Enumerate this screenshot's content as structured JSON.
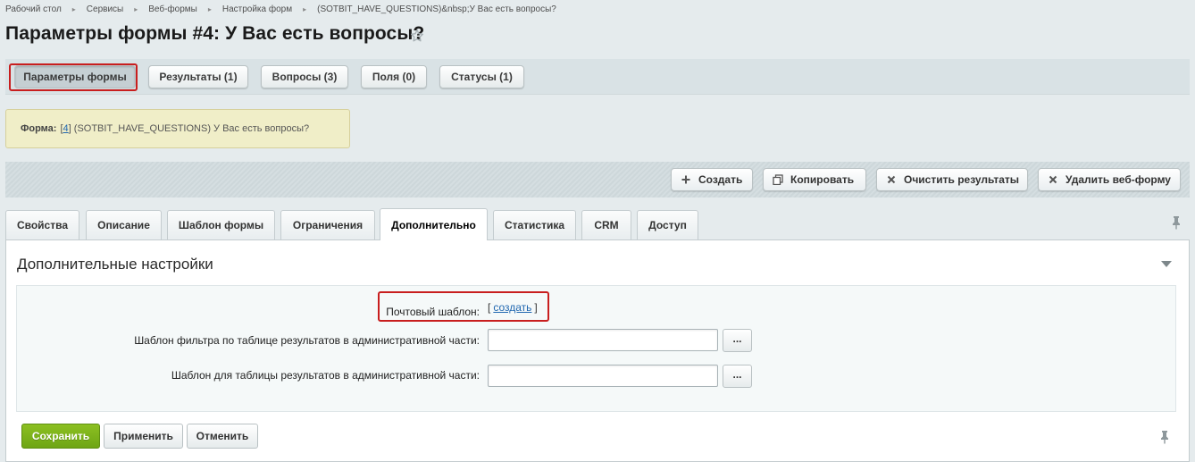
{
  "breadcrumb": {
    "items": [
      "Рабочий стол",
      "Сервисы",
      "Веб-формы",
      "Настройка форм",
      "(SOTBIT_HAVE_QUESTIONS)&nbsp;У Вас есть вопросы?"
    ]
  },
  "page_title": "Параметры формы #4: У Вас есть вопросы?",
  "context_tabs": [
    {
      "label": "Параметры формы",
      "active": true
    },
    {
      "label": "Результаты (1)"
    },
    {
      "label": "Вопросы (3)"
    },
    {
      "label": "Поля (0)"
    },
    {
      "label": "Статусы (1)"
    }
  ],
  "note": {
    "label": "Форма:",
    "id_link": "4",
    "text": "(SOTBIT_HAVE_QUESTIONS) У Вас есть вопросы?"
  },
  "toolbar": {
    "create": "Создать",
    "copy": "Копировать",
    "clear_results": "Очистить результаты",
    "delete_form": "Удалить веб-форму"
  },
  "tabs": [
    {
      "label": "Свойства"
    },
    {
      "label": "Описание"
    },
    {
      "label": "Шаблон формы"
    },
    {
      "label": "Ограничения"
    },
    {
      "label": "Дополнительно",
      "active": true
    },
    {
      "label": "Статистика"
    },
    {
      "label": "CRM"
    },
    {
      "label": "Доступ"
    }
  ],
  "section": {
    "title": "Дополнительные настройки",
    "fields": {
      "mail_template": {
        "label": "Почтовый шаблон:",
        "open_bracket": "[",
        "link": "создать",
        "close_bracket": "]"
      },
      "filter_template": {
        "label": "Шаблон фильтра по таблице результатов в административной части:",
        "value": "",
        "button": "..."
      },
      "table_template": {
        "label": "Шаблон для таблицы результатов в административной части:",
        "value": "",
        "button": "..."
      }
    }
  },
  "actions": {
    "save": "Сохранить",
    "apply": "Применить",
    "cancel": "Отменить"
  },
  "colors": {
    "highlight": "#c81e1e",
    "save_button": "#7ab21a",
    "link": "#2067b0",
    "note_bg": "#f0eec8"
  }
}
